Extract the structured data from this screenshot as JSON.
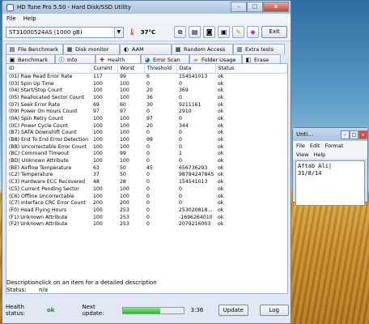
{
  "window": {
    "title": "HD Tune Pro 5.50 - Hard Disk/SSD Utility",
    "min": "–",
    "max": "□",
    "close": "x"
  },
  "menu": {
    "file": "File",
    "help": "Help"
  },
  "toolbar": {
    "drive": "ST31000524AS (1000 gB)",
    "temperature": "37°C",
    "exit": "Exit"
  },
  "tabs_top": [
    {
      "label": "File Benchmark",
      "icon": "file-icon"
    },
    {
      "label": "Disk monitor",
      "icon": "monitor-icon"
    },
    {
      "label": "AAM",
      "icon": "speaker-icon"
    },
    {
      "label": "Random Access",
      "icon": "random-access-icon"
    },
    {
      "label": "Extra tests",
      "icon": "extra-tests-icon"
    }
  ],
  "tabs_bottom": [
    {
      "label": "Benchmark",
      "icon": "benchmark-icon"
    },
    {
      "label": "Info",
      "icon": "info-icon"
    },
    {
      "label": "Health",
      "icon": "health-icon"
    },
    {
      "label": "Error Scan",
      "icon": "error-scan-icon"
    },
    {
      "label": "Folder Usage",
      "icon": "folder-icon"
    },
    {
      "label": "Erase",
      "icon": "erase-icon"
    }
  ],
  "active_tab": "Health",
  "table": {
    "columns": [
      "ID",
      "Current",
      "Worst",
      "Threshold",
      "Data",
      "Status"
    ],
    "rows": [
      [
        "(01) Raw Read Error Rate",
        "117",
        "99",
        "6",
        "154541013",
        "ok"
      ],
      [
        "(03) Spin Up Time",
        "100",
        "100",
        "0",
        "0",
        "ok"
      ],
      [
        "(04) Start/Stop Count",
        "100",
        "100",
        "20",
        "369",
        "ok"
      ],
      [
        "(05) Reallocated Sector Count",
        "100",
        "100",
        "36",
        "0",
        "ok"
      ],
      [
        "(07) Seek Error Rate",
        "69",
        "60",
        "30",
        "9211161",
        "ok"
      ],
      [
        "(09) Power On Hours Count",
        "97",
        "97",
        "0",
        "2910",
        "ok"
      ],
      [
        "(0A) Spin Retry Count",
        "100",
        "100",
        "97",
        "0",
        "ok"
      ],
      [
        "(0C) Power Cycle Count",
        "100",
        "100",
        "20",
        "344",
        "ok"
      ],
      [
        "(B7) SATA Downshift Count",
        "100",
        "100",
        "0",
        "0",
        "ok"
      ],
      [
        "(B8) End To End Error Detection",
        "100",
        "100",
        "99",
        "0",
        "ok"
      ],
      [
        "(BB) Uncorrectable Error Count",
        "100",
        "100",
        "0",
        "0",
        "ok"
      ],
      [
        "(BC) Command Timeout",
        "100",
        "99",
        "0",
        "1",
        "ok"
      ],
      [
        "(BD) Unknown Attribute",
        "100",
        "100",
        "0",
        "0",
        "ok"
      ],
      [
        "(BE) Airflow Temperature",
        "63",
        "50",
        "45",
        "656736293",
        "ok"
      ],
      [
        "(C2) Temperature",
        "37",
        "50",
        "0",
        "98784247845",
        "ok"
      ],
      [
        "(C3) Hardware ECC Recovered",
        "48",
        "28",
        "0",
        "154541013",
        "ok"
      ],
      [
        "(C5) Current Pending Sector",
        "100",
        "100",
        "0",
        "0",
        "ok"
      ],
      [
        "(C6) Offline Uncorrectable",
        "100",
        "100",
        "0",
        "0",
        "ok"
      ],
      [
        "(C7) Interface CRC Error Count",
        "200",
        "200",
        "0",
        "0",
        "ok"
      ],
      [
        "(F0) Head Flying Hours",
        "100",
        "253",
        "0",
        "253020818...",
        "ok"
      ],
      [
        "(F1) Unknown Attribute",
        "100",
        "253",
        "0",
        "-1696264010",
        "ok"
      ],
      [
        "(F2) Unknown Attribute",
        "100",
        "253",
        "0",
        "2079216003",
        "ok"
      ]
    ]
  },
  "description": {
    "desc_label": "Description:",
    "desc_value": "click on an item for a detailed description",
    "status_label": "Status:",
    "status_value": "n/a"
  },
  "statusbar": {
    "health_label": "Health status:",
    "health_value": "ok",
    "next_label": "Next update:",
    "progress_fraction": 0.62,
    "countdown": "3:36",
    "update": "Update",
    "log": "Log"
  },
  "notepad": {
    "title": "Unti...",
    "menu": [
      "File",
      "Edit",
      "Format",
      "View",
      "Help"
    ],
    "text": "Aftab Ali|\n31/8/14"
  }
}
